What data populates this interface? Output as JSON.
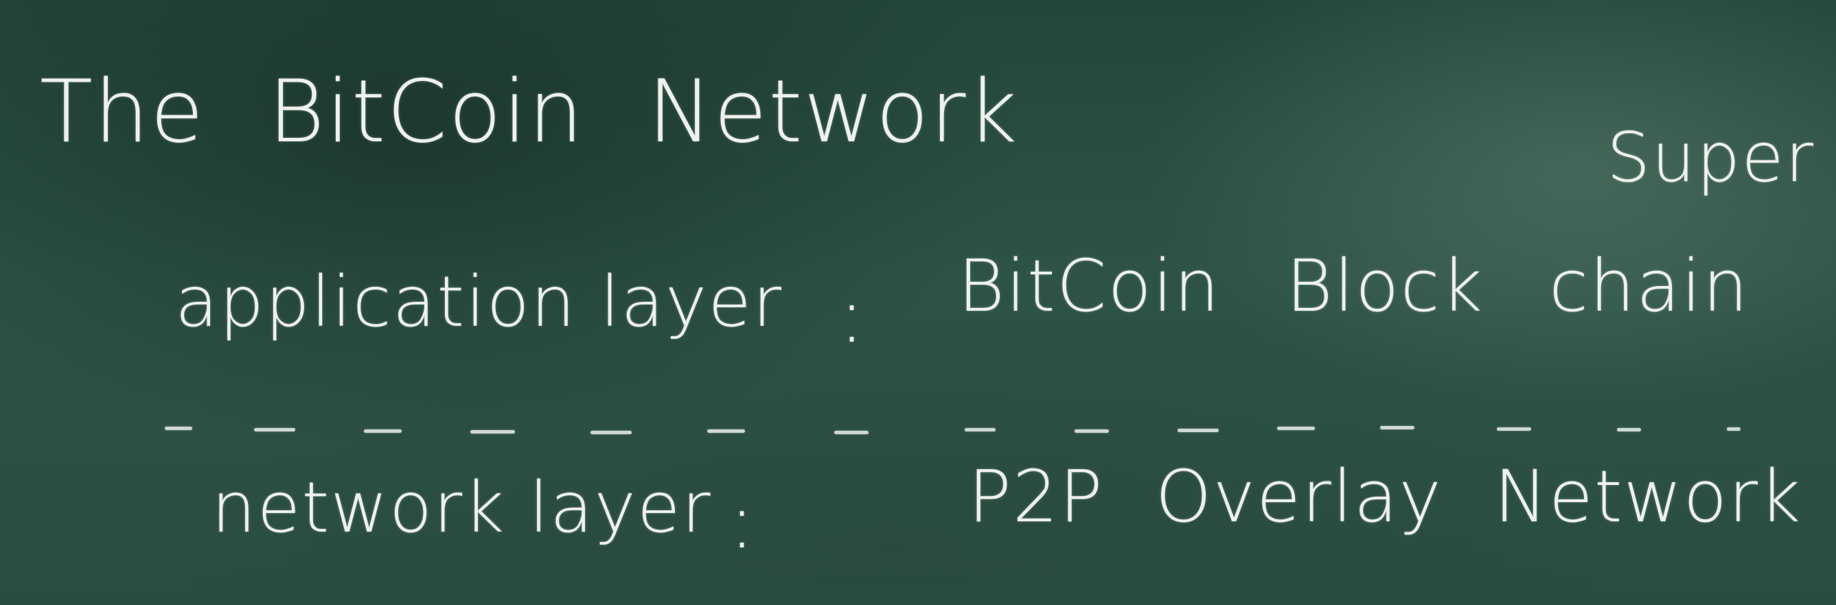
{
  "board": {
    "title": "The BitCoin Network",
    "corner_note": "Super",
    "rows": [
      {
        "label": "application layer",
        "separator": ":",
        "value": "BitCoin Block chain"
      },
      {
        "label": "network layer",
        "separator": ":",
        "value": "P2P Overlay Network"
      }
    ]
  }
}
